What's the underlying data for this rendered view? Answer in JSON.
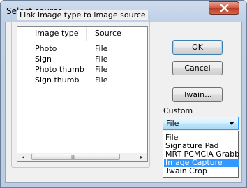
{
  "window": {
    "title": "Select source",
    "close_icon": "close-x-icon"
  },
  "group": {
    "label": "Link image type to image source",
    "columns": [
      "Image type",
      "Source"
    ],
    "rows": [
      {
        "type": "Photo",
        "source": "File"
      },
      {
        "type": "Sign",
        "source": "File"
      },
      {
        "type": "Photo thumb",
        "source": "File"
      },
      {
        "type": "Sign thumb",
        "source": "File"
      }
    ],
    "scrollbar": {
      "left_arrow": "◂",
      "right_arrow": "▸",
      "grip": "III"
    }
  },
  "buttons": {
    "ok": "OK",
    "cancel": "Cancel",
    "twain": "Twain..."
  },
  "custom": {
    "label": "Custom",
    "selected": "File",
    "options": [
      "File",
      "Signature Pad",
      "MRT PCMCIA Grabber",
      "Image Capture",
      "Twain Crop"
    ],
    "highlighted": "Image Capture"
  }
}
